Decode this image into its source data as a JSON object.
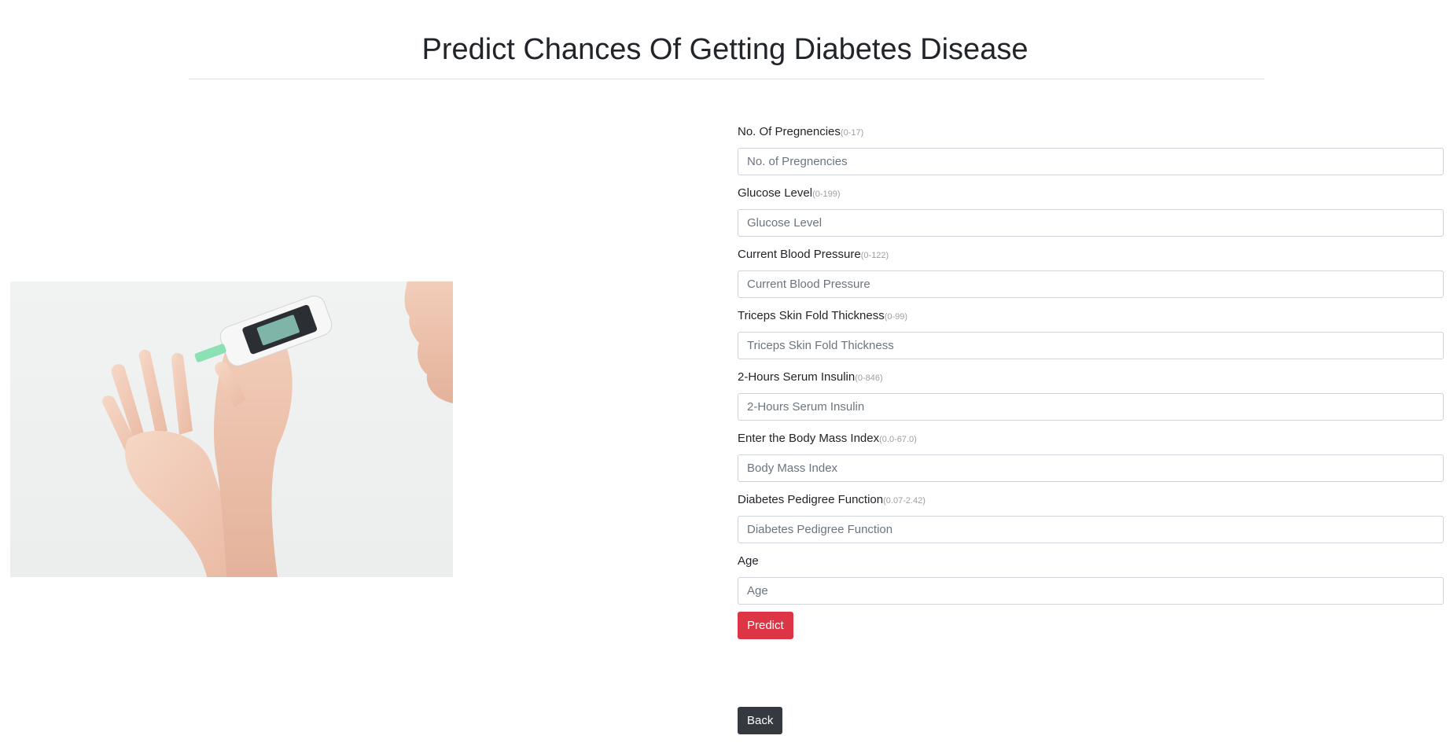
{
  "header": {
    "title": "Predict Chances Of Getting Diabetes Disease"
  },
  "form": {
    "fields": [
      {
        "label": "No. Of Pregnencies",
        "range": "(0-17)",
        "placeholder": "No. of Pregnencies",
        "value": ""
      },
      {
        "label": "Glucose Level",
        "range": "(0-199)",
        "placeholder": "Glucose Level",
        "value": ""
      },
      {
        "label": "Current Blood Pressure",
        "range": "(0-122)",
        "placeholder": "Current Blood Pressure",
        "value": ""
      },
      {
        "label": "Triceps Skin Fold Thickness",
        "range": "(0-99)",
        "placeholder": "Triceps Skin Fold Thickness",
        "value": ""
      },
      {
        "label": "2-Hours Serum Insulin",
        "range": "(0-846)",
        "placeholder": "2-Hours Serum Insulin",
        "value": ""
      },
      {
        "label": "Enter the Body Mass Index",
        "range": "(0.0-67.0)",
        "placeholder": "Body Mass Index",
        "value": ""
      },
      {
        "label": "Diabetes Pedigree Function",
        "range": "(0.07-2.42)",
        "placeholder": "Diabetes Pedigree Function",
        "value": ""
      },
      {
        "label": "Age",
        "range": "",
        "placeholder": "Age",
        "value": ""
      }
    ],
    "predict_label": "Predict",
    "back_label": "Back"
  },
  "colors": {
    "predict_button": "#dc3545",
    "back_button": "#343a40"
  },
  "illustration": {
    "icon": "glucose-meter-photo"
  }
}
